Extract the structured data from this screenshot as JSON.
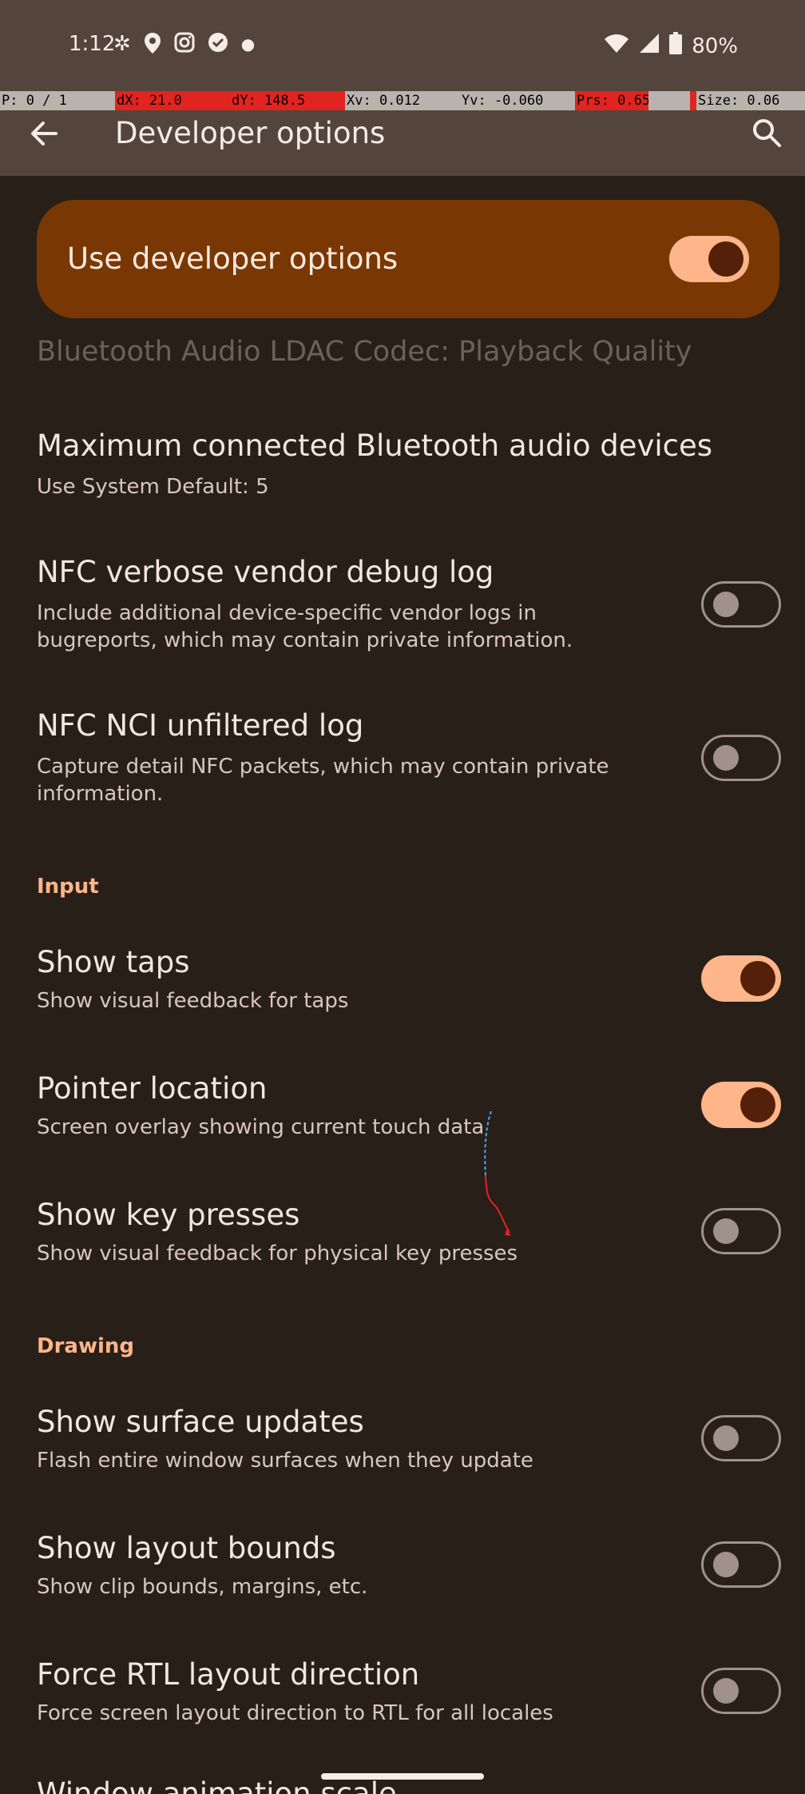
{
  "status_bar": {
    "time": "1:12",
    "battery": "80%",
    "left_icons": [
      "pinwheel-icon",
      "location-icon",
      "instagram-icon",
      "check-circle-icon",
      "dot-icon"
    ],
    "right_icons": [
      "wifi-icon",
      "signal-icon",
      "battery-icon"
    ]
  },
  "pointer_overlay": {
    "p": "P: 0 / 1",
    "dx": "dX: 21.0",
    "dy": "dY: 148.5",
    "xv": "Xv: 0.012",
    "yv": "Yv: -0.060",
    "prs": "Prs: 0.65",
    "size": "Size: 0.06"
  },
  "app_bar": {
    "title": "Developer options"
  },
  "master_switch": {
    "label": "Use developer options",
    "on": true
  },
  "faded_item": "Bluetooth Audio LDAC Codec: Playback Quality",
  "items": [
    {
      "title": "Maximum connected Bluetooth audio devices",
      "subtitle": "Use System Default: 5"
    },
    {
      "title": "NFC verbose vendor debug log",
      "subtitle": "Include additional device-specific vendor logs in bugreports, which may contain private information.",
      "on": false
    },
    {
      "title": "NFC NCI unfiltered log",
      "subtitle": "Capture detail NFC packets, which may contain private information.",
      "on": false
    },
    {
      "title": "Show taps",
      "subtitle": "Show visual feedback for taps",
      "on": true
    },
    {
      "title": "Pointer location",
      "subtitle": "Screen overlay showing current touch data",
      "on": true
    },
    {
      "title": "Show key presses",
      "subtitle": "Show visual feedback for physical key presses",
      "on": false
    },
    {
      "title": "Show surface updates",
      "subtitle": "Flash entire window surfaces when they update",
      "on": false
    },
    {
      "title": "Show layout bounds",
      "subtitle": "Show clip bounds, margins, etc.",
      "on": false
    },
    {
      "title": "Force RTL layout direction",
      "subtitle": "Force screen layout direction to RTL for all locales",
      "on": false
    },
    {
      "title": "Window animation scale"
    }
  ],
  "sections": {
    "input": "Input",
    "drawing": "Drawing"
  },
  "colors": {
    "accent": "#ffb58a",
    "background": "#281f19",
    "app_bar": "#54453c",
    "master_bg": "#793803"
  }
}
